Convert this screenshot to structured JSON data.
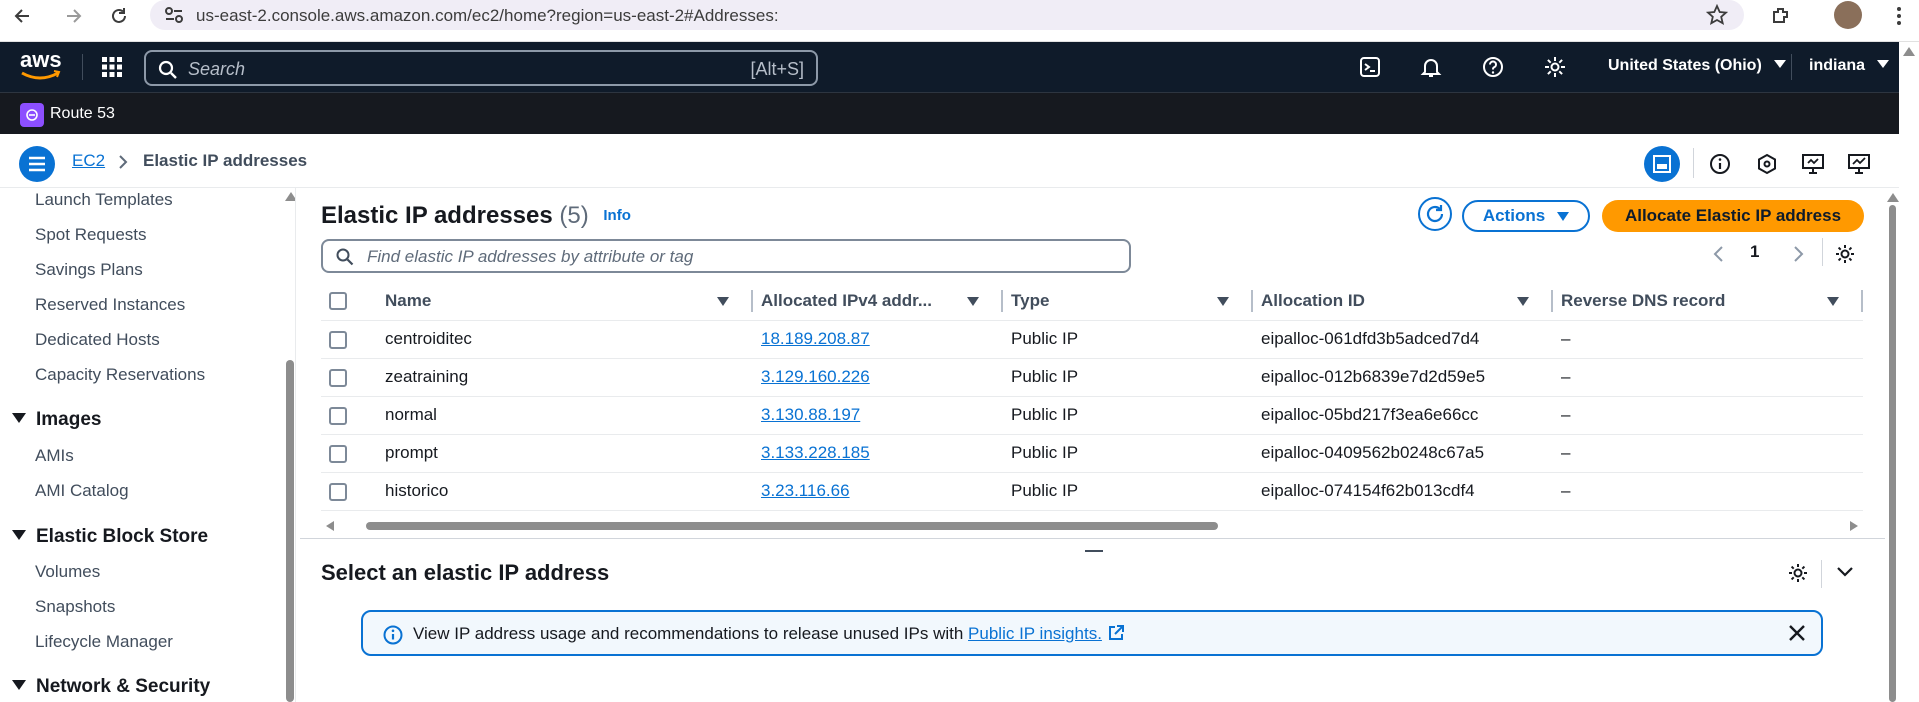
{
  "browser": {
    "url": "us-east-2.console.aws.amazon.com/ec2/home?region=us-east-2#Addresses:"
  },
  "nav": {
    "logo": "aws",
    "search_placeholder": "Search",
    "search_shortcut": "[Alt+S]",
    "region": "United States (Ohio)",
    "user": "indiana"
  },
  "favorites": {
    "items": [
      {
        "label": "Route 53"
      }
    ]
  },
  "breadcrumb": {
    "parent": "EC2",
    "current": "Elastic IP addresses"
  },
  "sidebar": {
    "items": [
      {
        "type": "item",
        "label": "Launch Templates"
      },
      {
        "type": "item",
        "label": "Spot Requests"
      },
      {
        "type": "item",
        "label": "Savings Plans"
      },
      {
        "type": "item",
        "label": "Reserved Instances"
      },
      {
        "type": "item",
        "label": "Dedicated Hosts"
      },
      {
        "type": "item",
        "label": "Capacity Reservations"
      },
      {
        "type": "head",
        "label": "Images"
      },
      {
        "type": "item",
        "label": "AMIs"
      },
      {
        "type": "item",
        "label": "AMI Catalog"
      },
      {
        "type": "head",
        "label": "Elastic Block Store"
      },
      {
        "type": "item",
        "label": "Volumes"
      },
      {
        "type": "item",
        "label": "Snapshots"
      },
      {
        "type": "item",
        "label": "Lifecycle Manager"
      },
      {
        "type": "head",
        "label": "Network & Security"
      }
    ]
  },
  "main": {
    "title": "Elastic IP addresses",
    "count": "(5)",
    "info": "Info",
    "actions_label": "Actions",
    "allocate_label": "Allocate Elastic IP address",
    "filter_placeholder": "Find elastic IP addresses by attribute or tag",
    "page": "1"
  },
  "table": {
    "columns": [
      "Name",
      "Allocated IPv4 addr...",
      "Type",
      "Allocation ID",
      "Reverse DNS record"
    ],
    "rows": [
      {
        "name": "centroiditec",
        "ip": "18.189.208.87",
        "type": "Public IP",
        "allocation_id": "eipalloc-061dfd3b5adced7d4",
        "dns": "–"
      },
      {
        "name": "zeatraining",
        "ip": "3.129.160.226",
        "type": "Public IP",
        "allocation_id": "eipalloc-012b6839e7d2d59e5",
        "dns": "–"
      },
      {
        "name": "normal",
        "ip": "3.130.88.197",
        "type": "Public IP",
        "allocation_id": "eipalloc-05bd217f3ea6e66cc",
        "dns": "–"
      },
      {
        "name": "prompt",
        "ip": "3.133.228.185",
        "type": "Public IP",
        "allocation_id": "eipalloc-0409562b0248c67a5",
        "dns": "–"
      },
      {
        "name": "historico",
        "ip": "3.23.116.66",
        "type": "Public IP",
        "allocation_id": "eipalloc-074154f62b013cdf4",
        "dns": "–"
      }
    ]
  },
  "detail": {
    "title": "Select an elastic IP address",
    "alert_text": "View IP address usage and recommendations to release unused IPs with ",
    "alert_link": "Public IP insights."
  },
  "colors": {
    "nav_bg": "#0f1b2a",
    "link": "#0972d3",
    "primary_button": "#ff9900"
  },
  "icons": {
    "browser": [
      "back-icon",
      "forward-icon",
      "reload-icon",
      "site-info-icon",
      "star-icon",
      "extensions-icon",
      "profile-avatar",
      "kebab-menu-icon"
    ],
    "nav": [
      "services-grid-icon",
      "search-icon",
      "cloudshell-icon",
      "bell-icon",
      "help-icon",
      "settings-gear-icon"
    ],
    "tools": [
      "split-panel-icon",
      "info-icon",
      "security-hub-icon",
      "monitor-icon",
      "screen-chart-icon"
    ]
  }
}
